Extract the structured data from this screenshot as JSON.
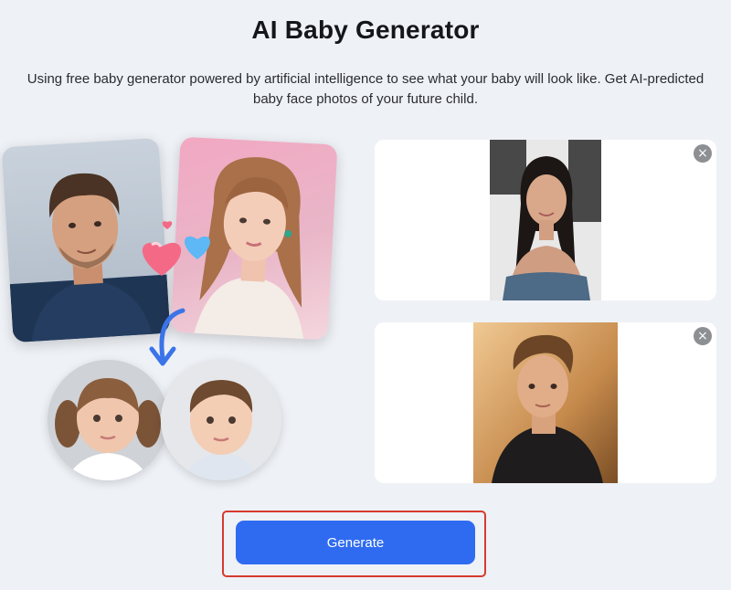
{
  "header": {
    "title": "AI Baby Generator",
    "description": "Using free baby generator powered by artificial intelligence to see what your baby will look like. Get AI-predicted baby face photos of your future child."
  },
  "illustration": {
    "icons": [
      "heart-icon",
      "arrow-down-icon"
    ]
  },
  "uploads": {
    "close_symbol": "×"
  },
  "actions": {
    "generate_label": "Generate"
  },
  "colors": {
    "background": "#eef1f6",
    "primary": "#2f6bf0",
    "highlight": "#d63a2f",
    "heart_pink": "#f46a86",
    "heart_blue": "#5db8f5"
  }
}
